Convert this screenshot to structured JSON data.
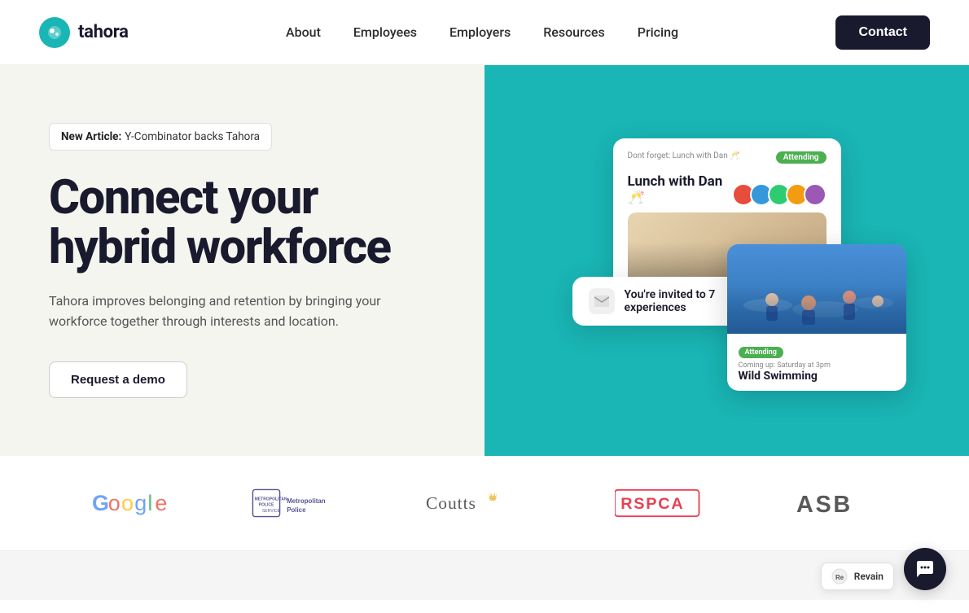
{
  "nav": {
    "logo_text": "tahora",
    "links": [
      {
        "id": "about",
        "label": "About"
      },
      {
        "id": "employees",
        "label": "Employees"
      },
      {
        "id": "employers",
        "label": "Employers"
      },
      {
        "id": "resources",
        "label": "Resources"
      },
      {
        "id": "pricing",
        "label": "Pricing"
      }
    ],
    "cta": "Contact"
  },
  "hero": {
    "badge_label": "New Article:",
    "badge_text": "Y-Combinator backs Tahora",
    "title_line1": "Connect your",
    "title_line2": "hybrid workforce",
    "subtitle": "Tahora improves belonging and retention by bringing your workforce together through interests and location.",
    "cta_label": "Request a demo",
    "card_invite_text": "You're invited to 7 experiences",
    "card_lunch_label": "Dont forget: Lunch with Dan 🥂",
    "card_lunch_title": "Lunch with Dan 🥂",
    "card_swim_label": "Coming up: Saturday at 3pm",
    "card_swim_title": "Wild Swimming",
    "attending_label": "Attending"
  },
  "logos": [
    {
      "id": "google",
      "name": "Google"
    },
    {
      "id": "met-police",
      "name": "Metropolitan Police"
    },
    {
      "id": "coutts",
      "name": "Coutts"
    },
    {
      "id": "rspca",
      "name": "RSPCA"
    },
    {
      "id": "asb",
      "name": "ASB"
    }
  ],
  "chat": {
    "label": "Chat"
  },
  "revain": {
    "label": "Revain"
  }
}
